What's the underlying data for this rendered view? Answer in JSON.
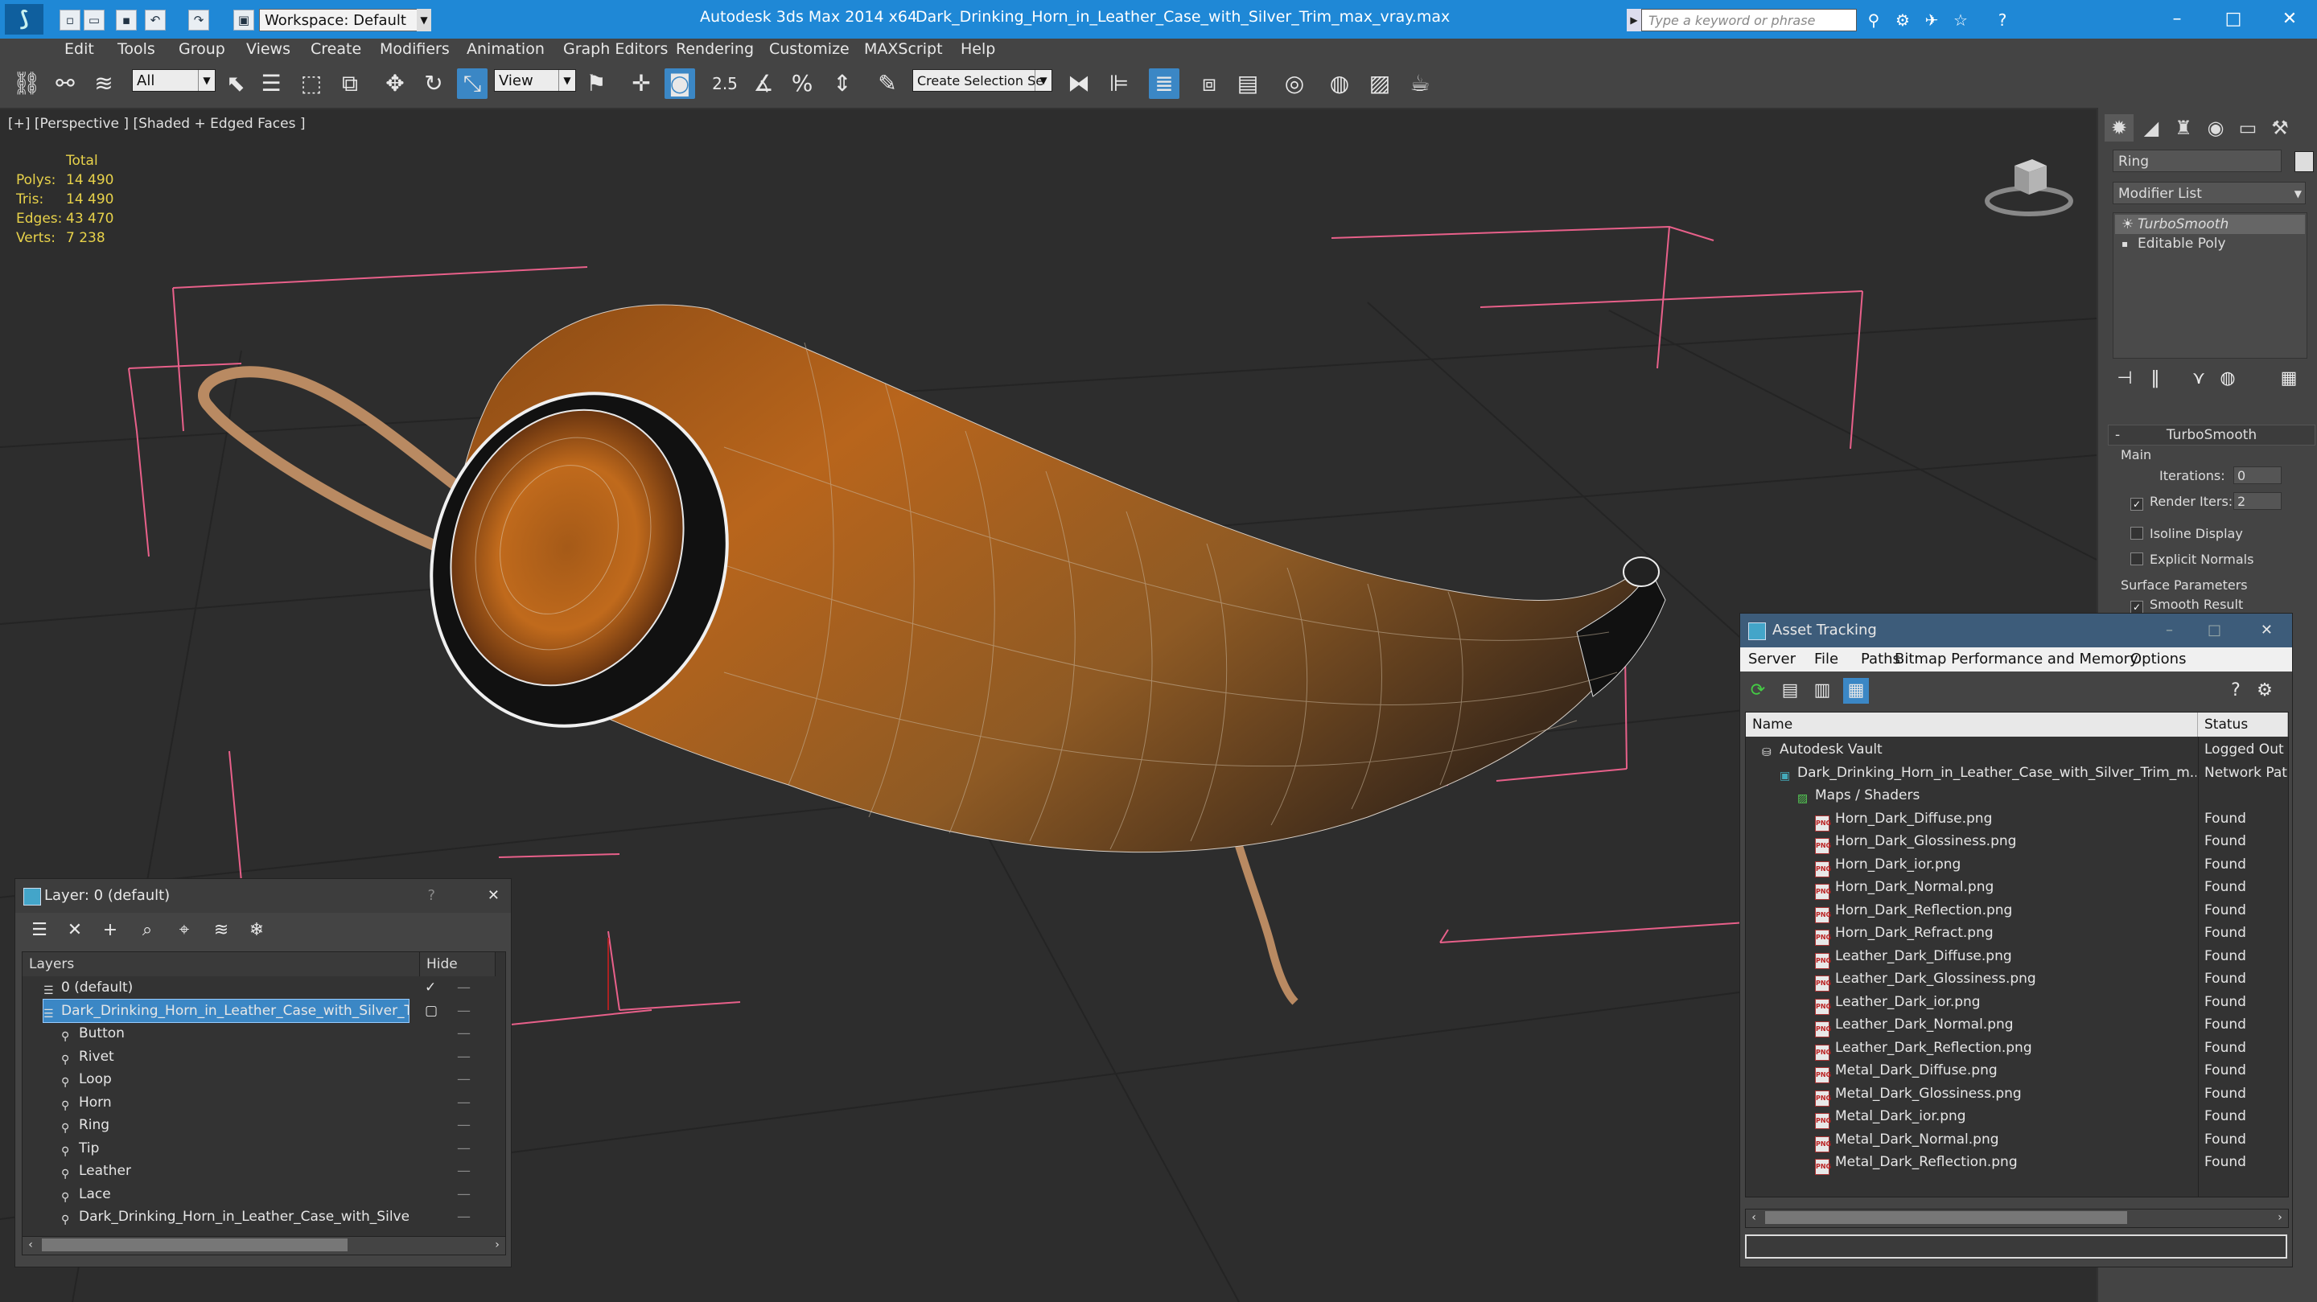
{
  "titlebar": {
    "app_title": "Autodesk 3ds Max  2014 x64",
    "file_name": "Dark_Drinking_Horn_in_Leather_Case_with_Silver_Trim_max_vray.max",
    "workspace": "Workspace: Default",
    "search_placeholder": "Type a keyword or phrase"
  },
  "menu": [
    "Edit",
    "Tools",
    "Group",
    "Views",
    "Create",
    "Modifiers",
    "Animation",
    "Graph Editors",
    "Rendering",
    "Customize",
    "MAXScript",
    "Help"
  ],
  "toolbar": {
    "filter_value": "All",
    "refcoord_value": "View",
    "snap_value": "2.5",
    "selection_set_placeholder": "Create Selection Se"
  },
  "viewport": {
    "label": "[+] [Perspective ] [Shaded + Edged Faces ]",
    "stats": {
      "header": "Total",
      "rows": [
        {
          "label": "Polys:",
          "value": "14 490"
        },
        {
          "label": "Tris:",
          "value": "14 490"
        },
        {
          "label": "Edges:",
          "value": "43 470"
        },
        {
          "label": "Verts:",
          "value": "7 238"
        }
      ]
    }
  },
  "command_panel": {
    "object_name": "Ring",
    "modifier_list": "Modifier List",
    "stack": [
      "TurboSmooth",
      "Editable Poly"
    ],
    "rollout_title": "TurboSmooth",
    "main_label": "Main",
    "iterations_label": "Iterations:",
    "iterations_value": "0",
    "render_iters_label": "Render Iters:",
    "render_iters_value": "2",
    "isoline_label": "Isoline Display",
    "explicit_normals_label": "Explicit Normals",
    "surface_params_label": "Surface Parameters",
    "smooth_result_label": "Smooth Result"
  },
  "layers_panel": {
    "title": "Layer: 0 (default)",
    "help": "?",
    "col_layers": "Layers",
    "col_hide": "Hide",
    "rows": [
      {
        "name": "0 (default)",
        "level": 0,
        "selected": false
      },
      {
        "name": "Dark_Drinking_Horn_in_Leather_Case_with_Silver_Trim",
        "level": 0,
        "selected": true
      },
      {
        "name": "Button",
        "level": 1,
        "selected": false
      },
      {
        "name": "Rivet",
        "level": 1,
        "selected": false
      },
      {
        "name": "Loop",
        "level": 1,
        "selected": false
      },
      {
        "name": "Horn",
        "level": 1,
        "selected": false
      },
      {
        "name": "Ring",
        "level": 1,
        "selected": false
      },
      {
        "name": "Tip",
        "level": 1,
        "selected": false
      },
      {
        "name": "Leather",
        "level": 1,
        "selected": false
      },
      {
        "name": "Lace",
        "level": 1,
        "selected": false
      },
      {
        "name": "Dark_Drinking_Horn_in_Leather_Case_with_Silver_Trim",
        "level": 1,
        "selected": false
      }
    ]
  },
  "asset_panel": {
    "title": "Asset Tracking",
    "menu": [
      "Server",
      "File",
      "Paths",
      "Bitmap Performance and Memory",
      "Options"
    ],
    "col_name": "Name",
    "col_status": "Status",
    "rows": [
      {
        "name": "Autodesk Vault",
        "status": "Logged Out",
        "level": 0,
        "kind": "vault"
      },
      {
        "name": "Dark_Drinking_Horn_in_Leather_Case_with_Silver_Trim_m...",
        "status": "Network Path",
        "level": 1,
        "kind": "max"
      },
      {
        "name": "Maps / Shaders",
        "status": "",
        "level": 2,
        "kind": "maps"
      },
      {
        "name": "Horn_Dark_Diffuse.png",
        "status": "Found",
        "level": 3,
        "kind": "png"
      },
      {
        "name": "Horn_Dark_Glossiness.png",
        "status": "Found",
        "level": 3,
        "kind": "png"
      },
      {
        "name": "Horn_Dark_ior.png",
        "status": "Found",
        "level": 3,
        "kind": "png"
      },
      {
        "name": "Horn_Dark_Normal.png",
        "status": "Found",
        "level": 3,
        "kind": "png"
      },
      {
        "name": "Horn_Dark_Reflection.png",
        "status": "Found",
        "level": 3,
        "kind": "png"
      },
      {
        "name": "Horn_Dark_Refract.png",
        "status": "Found",
        "level": 3,
        "kind": "png"
      },
      {
        "name": "Leather_Dark_Diffuse.png",
        "status": "Found",
        "level": 3,
        "kind": "png"
      },
      {
        "name": "Leather_Dark_Glossiness.png",
        "status": "Found",
        "level": 3,
        "kind": "png"
      },
      {
        "name": "Leather_Dark_ior.png",
        "status": "Found",
        "level": 3,
        "kind": "png"
      },
      {
        "name": "Leather_Dark_Normal.png",
        "status": "Found",
        "level": 3,
        "kind": "png"
      },
      {
        "name": "Leather_Dark_Reflection.png",
        "status": "Found",
        "level": 3,
        "kind": "png"
      },
      {
        "name": "Metal_Dark_Diffuse.png",
        "status": "Found",
        "level": 3,
        "kind": "png"
      },
      {
        "name": "Metal_Dark_Glossiness.png",
        "status": "Found",
        "level": 3,
        "kind": "png"
      },
      {
        "name": "Metal_Dark_ior.png",
        "status": "Found",
        "level": 3,
        "kind": "png"
      },
      {
        "name": "Metal_Dark_Normal.png",
        "status": "Found",
        "level": 3,
        "kind": "png"
      },
      {
        "name": "Metal_Dark_Reflection.png",
        "status": "Found",
        "level": 3,
        "kind": "png"
      }
    ]
  },
  "colors": {
    "titlebar": "#1f88d6",
    "ui_gray": "#444444",
    "viewport_bg": "#2d2d2d",
    "selection": "#3b87c5",
    "stats_text": "#e8d24a"
  }
}
